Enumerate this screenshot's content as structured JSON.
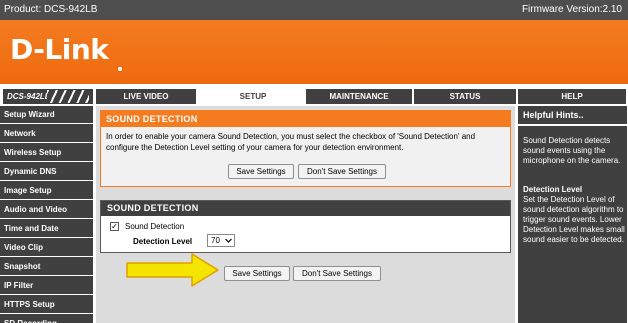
{
  "header": {
    "product": "Product: DCS-942LB",
    "firmware": "Firmware Version:2.10"
  },
  "brand": {
    "logo": "D-Link",
    "model": "DCS-942LB"
  },
  "tabs": [
    {
      "label": "LIVE VIDEO",
      "active": false
    },
    {
      "label": "SETUP",
      "active": true
    },
    {
      "label": "MAINTENANCE",
      "active": false
    },
    {
      "label": "STATUS",
      "active": false
    },
    {
      "label": "HELP",
      "active": false
    }
  ],
  "sidebar": {
    "items": [
      {
        "label": "Setup Wizard"
      },
      {
        "label": "Network"
      },
      {
        "label": "Wireless Setup"
      },
      {
        "label": "Dynamic DNS"
      },
      {
        "label": "Image Setup"
      },
      {
        "label": "Audio and Video"
      },
      {
        "label": "Time and Date"
      },
      {
        "label": "Video Clip"
      },
      {
        "label": "Snapshot"
      },
      {
        "label": "IP Filter"
      },
      {
        "label": "HTTPS Setup"
      },
      {
        "label": "SD Recording"
      }
    ]
  },
  "intro_panel": {
    "title": "SOUND DETECTION",
    "description": "In order to enable your camera Sound Detection, you must select the checkbox of 'Sound Detection' and configure the Detection Level setting of your camera for your detection environment.",
    "save_label": "Save Settings",
    "dont_save_label": "Don't Save Settings"
  },
  "settings_panel": {
    "title": "SOUND DETECTION",
    "checkbox_label": "Sound Detection",
    "checkbox_checked": true,
    "checkbox_mark": "✓",
    "detection_level_label": "Detection Level",
    "detection_level_value": "70"
  },
  "bottom_buttons": {
    "save_label": "Save Settings",
    "dont_save_label": "Don't Save Settings"
  },
  "hints": {
    "title": "Helpful Hints..",
    "text1": "Sound Detection detects sound events using the microphone on the camera.",
    "subtitle": "Detection Level",
    "text2": "Set the Detection Level of sound detection algorithm to trigger sound events. Lower Detection Level makes small sound easier to be detected."
  },
  "colors": {
    "brand_orange": "#f47b20",
    "nav_gray": "#404040",
    "arrow_yellow": "#f5e400",
    "arrow_outline": "#e0a000"
  },
  "icons": {
    "checkbox": "checkmark-icon",
    "select": "chevron-down-icon",
    "annotation": "arrow-right-icon"
  }
}
